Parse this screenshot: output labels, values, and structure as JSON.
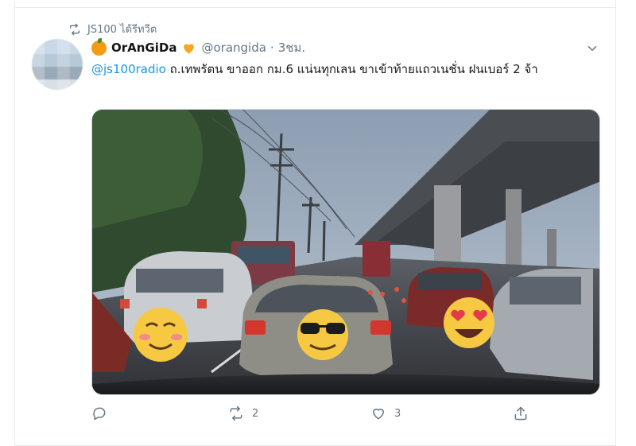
{
  "retweet": {
    "text": "JS100 ได้รีทวีต",
    "icon": "retweet-icon"
  },
  "tweet": {
    "display_name": "OrAnGiDa",
    "handle": "@orangida",
    "separator": "·",
    "time": "3ชม.",
    "name_emojis": [
      "orange-icon",
      "orange-heart-icon"
    ],
    "mention": "@js100radio",
    "text": " ถ.เทพรัตน ขาออก กม.6 แน่นทุกเลน ขาเข้าท้ายแถวเนชั่น ฝนเบอร์ 2 จ้า",
    "media_description": "rain-soaked traffic jam photo under an elevated expressway with emoji stickers on cars"
  },
  "actions": {
    "reply": {
      "icon": "reply-icon",
      "count": ""
    },
    "retweet": {
      "icon": "retweet-icon",
      "count": "2"
    },
    "like": {
      "icon": "heart-icon",
      "count": "3"
    },
    "share": {
      "icon": "share-icon",
      "count": ""
    }
  },
  "colors": {
    "accent": "#1b95e0",
    "secondary_text": "#657786",
    "border": "#e6ecf0",
    "emoji_yellow": "#f7c942"
  }
}
